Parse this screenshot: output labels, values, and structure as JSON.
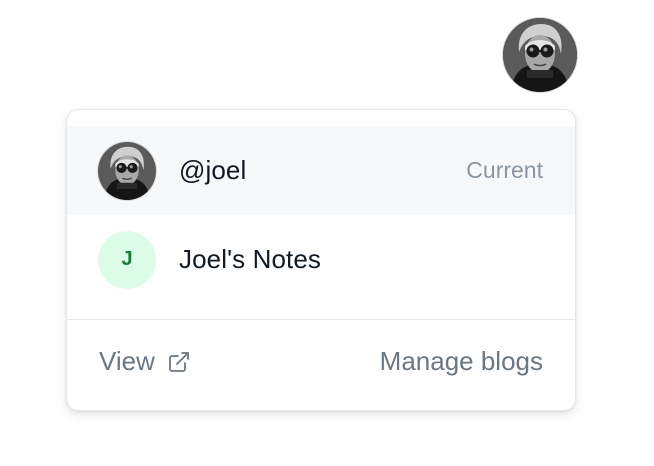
{
  "account_menu": {
    "accounts": [
      {
        "label": "@joel",
        "tag": "Current",
        "avatar": "photo"
      },
      {
        "label": "Joel's Notes",
        "avatar_letter": "J"
      }
    ],
    "footer": {
      "view_label": "View",
      "manage_label": "Manage blogs"
    }
  },
  "colors": {
    "current_row_bg": "#f6f8fa",
    "letter_avatar_bg": "#dcfce7",
    "letter_avatar_fg": "#15803d",
    "muted_text": "#6b7686"
  },
  "icons": [
    "user-avatar-photo",
    "external-link-icon"
  ]
}
